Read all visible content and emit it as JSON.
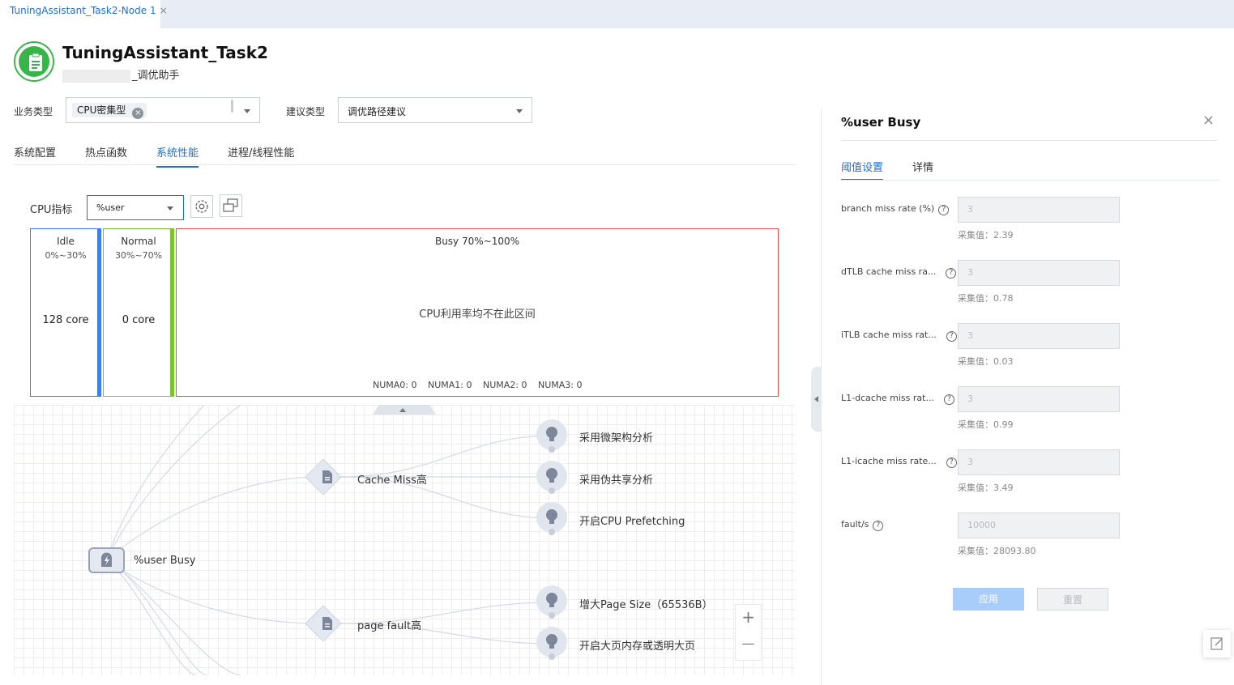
{
  "tab": {
    "label": "TuningAssistant_Task2-Node 1",
    "close": "×"
  },
  "header": {
    "title": "TuningAssistant_Task2",
    "subtitle": "_调优助手"
  },
  "filters": {
    "business_label": "业务类型",
    "business_value": "CPU密集型",
    "suggest_label": "建议类型",
    "suggest_value": "调优路径建议"
  },
  "nav_tabs": [
    "系统配置",
    "热点函数",
    "系统性能",
    "进程/线程性能"
  ],
  "nav_active": 2,
  "cpu": {
    "label": "CPU指标",
    "metric": "%user",
    "zones": [
      {
        "name": "Idle",
        "range": "0%~30%",
        "count": "128 core",
        "color": "#3c7fe6"
      },
      {
        "name": "Normal",
        "range": "30%~70%",
        "count": "0 core",
        "color": "#7cc42c"
      },
      {
        "name": "Busy 70%~100%",
        "message": "CPU利用率均不在此区间",
        "color": "#e25555",
        "numa": [
          "NUMA0: 0",
          "NUMA1: 0",
          "NUMA2: 0",
          "NUMA3: 0"
        ]
      }
    ]
  },
  "graph": {
    "root": "%user Busy",
    "groups": [
      {
        "label": "Cache Miss高",
        "suggestions": [
          "采用微架构分析",
          "采用伪共享分析",
          "开启CPU Prefetching"
        ]
      },
      {
        "label": "page fault高",
        "suggestions": [
          "增大Page Size（65536B）",
          "开启大页内存或透明大页"
        ]
      }
    ],
    "zoom_in": "+",
    "zoom_out": "—"
  },
  "panel": {
    "title": "%user Busy",
    "close": "×",
    "tabs": [
      "阈值设置",
      "详情"
    ],
    "fields": [
      {
        "label": "branch miss rate (%)",
        "placeholder": "3",
        "collected": "采集值：2.39"
      },
      {
        "label": "dTLB cache miss ra...",
        "placeholder": "3",
        "collected": "采集值：0.78"
      },
      {
        "label": "iTLB cache miss rat...",
        "placeholder": "3",
        "collected": "采集值：0.03"
      },
      {
        "label": "L1-dcache miss rat...",
        "placeholder": "3",
        "collected": "采集值：0.99"
      },
      {
        "label": "L1-icache miss rate...",
        "placeholder": "3",
        "collected": "采集值：3.49"
      },
      {
        "label": "fault/s",
        "placeholder": "10000",
        "collected": "采集值：28093.80"
      }
    ],
    "apply": "应用",
    "reset": "重置"
  },
  "colors": {
    "accent": "#1f6fd8",
    "logo": "#38b548",
    "apply_disabled": "#a9cdfa"
  }
}
